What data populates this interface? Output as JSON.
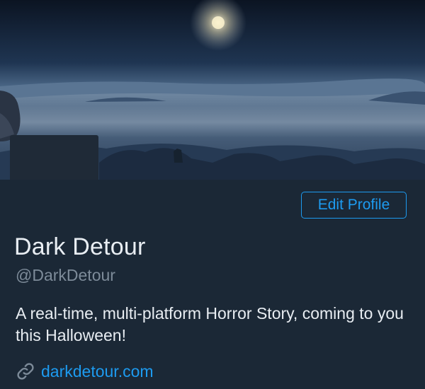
{
  "profile": {
    "banner_icon": "misty-moor-landscape",
    "avatar_icon": "avatar-placeholder",
    "edit_button_label": "Edit Profile",
    "display_name": "Dark Detour",
    "handle": "@DarkDetour",
    "bio": "A real-time, multi-platform Horror Story, coming to you this Halloween!",
    "website_icon": "link-icon",
    "website": "darkdetour.com"
  },
  "colors": {
    "background": "#1b2836",
    "accent": "#1d9bf0",
    "primary_text": "#e8edf2",
    "secondary_text": "#7d8b99"
  }
}
